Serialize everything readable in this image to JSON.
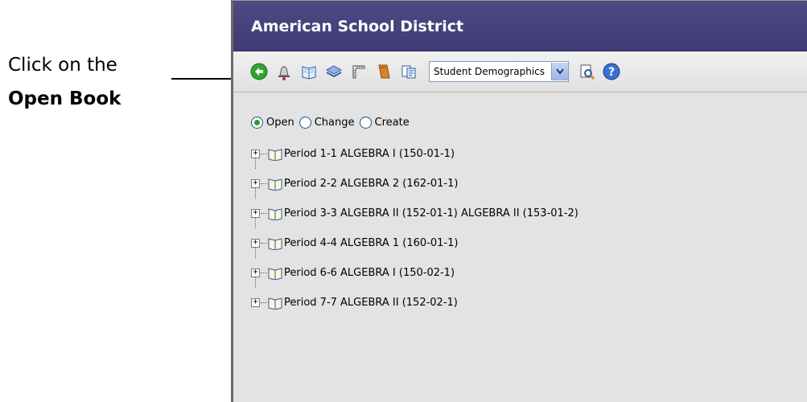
{
  "annotation": {
    "line1": "Click on the",
    "line2": "Open Book"
  },
  "window": {
    "title": "American School District"
  },
  "toolbar": {
    "icons": [
      "back-arrow-icon",
      "bell-icon",
      "open-book-icon",
      "layers-icon",
      "ruler-icon",
      "gradebook-icon",
      "copy-icon"
    ],
    "report_select_value": "Student Demographics",
    "preview_icon": "print-preview-icon",
    "help_icon": "help-icon"
  },
  "mode": {
    "options": [
      "Open",
      "Change",
      "Create"
    ],
    "selected": "Open"
  },
  "periods": [
    "Period 1-1 ALGEBRA I (150-01-1)",
    "Period 2-2 ALGEBRA 2 (162-01-1)",
    "Period 3-3 ALGEBRA II (152-01-1) ALGEBRA II (153-01-2)",
    "Period 4-4 ALGEBRA 1 (160-01-1)",
    "Period 6-6 ALGEBRA I (150-02-1)",
    "Period 7-7 ALGEBRA II (152-02-1)"
  ],
  "colors": {
    "titlebar": "#443f7d",
    "radio_selected": "#21a121"
  }
}
